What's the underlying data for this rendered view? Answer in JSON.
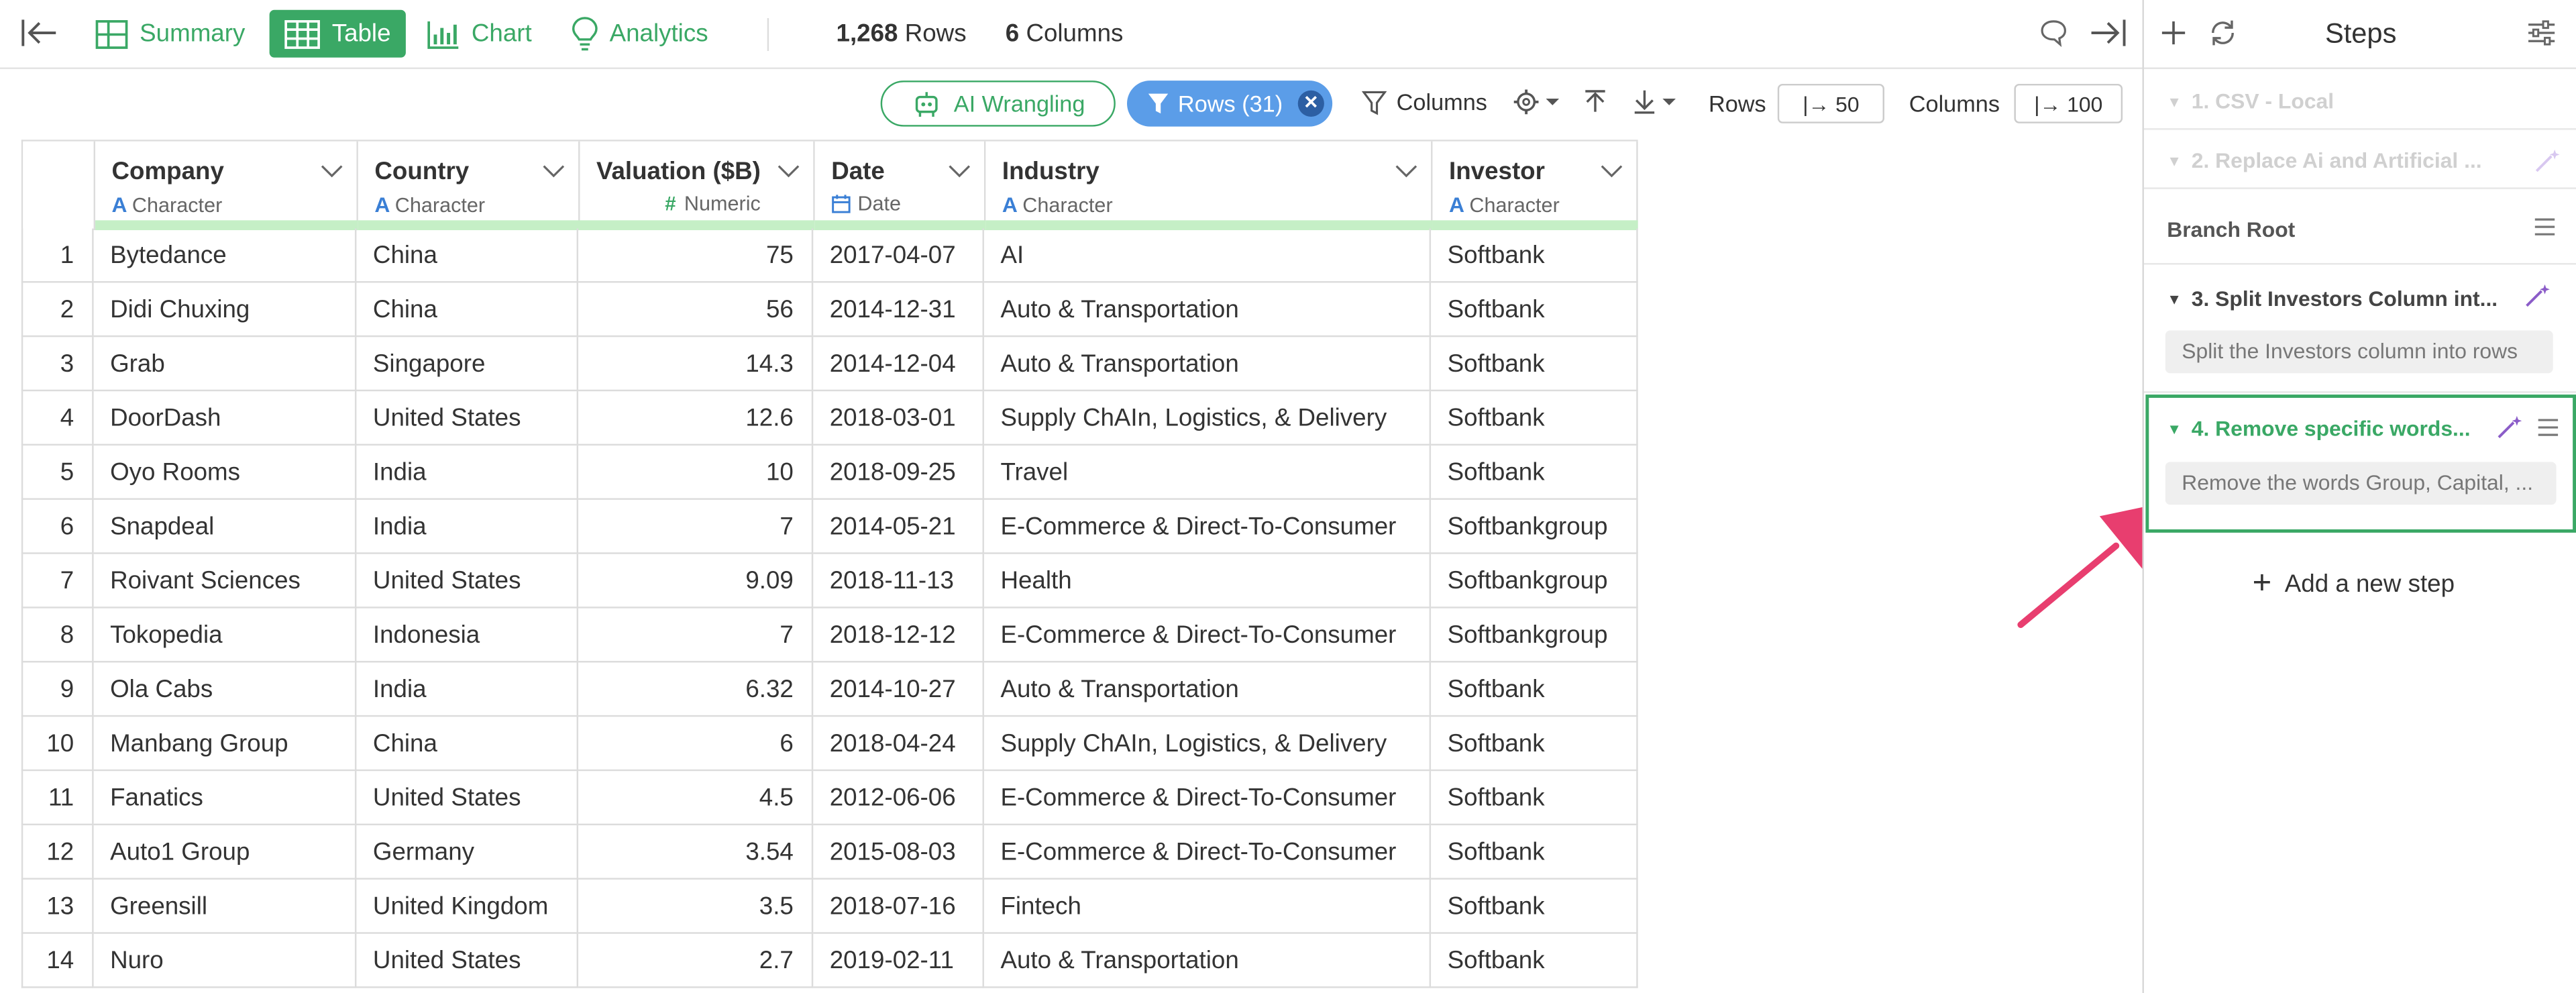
{
  "toolbar": {
    "tabs": [
      {
        "label": "Summary"
      },
      {
        "label": "Table"
      },
      {
        "label": "Chart"
      },
      {
        "label": "Analytics"
      }
    ],
    "rows_count": "1,268",
    "rows_label": "Rows",
    "cols_count": "6",
    "cols_label": "Columns",
    "ai_label": "AI Wrangling",
    "rows_filter_label": "Rows (31)",
    "columns_filter_label": "Columns",
    "rows_label2": "Rows",
    "rows_value": "|→ 50",
    "columns_label2": "Columns",
    "columns_value": "|→ 100"
  },
  "table": {
    "columns": [
      {
        "name": "Company",
        "type": "Character",
        "kind": "A"
      },
      {
        "name": "Country",
        "type": "Character",
        "kind": "A"
      },
      {
        "name": "Valuation ($B)",
        "type": "Numeric",
        "kind": "#"
      },
      {
        "name": "Date",
        "type": "Date",
        "kind": "date"
      },
      {
        "name": "Industry",
        "type": "Character",
        "kind": "A"
      },
      {
        "name": "Investor",
        "type": "Character",
        "kind": "A"
      }
    ],
    "rows": [
      [
        "1",
        "Bytedance",
        "China",
        "75",
        "2017-04-07",
        "AI",
        "Softbank"
      ],
      [
        "2",
        "Didi Chuxing",
        "China",
        "56",
        "2014-12-31",
        "Auto & Transportation",
        "Softbank"
      ],
      [
        "3",
        "Grab",
        "Singapore",
        "14.3",
        "2014-12-04",
        "Auto & Transportation",
        "Softbank"
      ],
      [
        "4",
        "DoorDash",
        "United States",
        "12.6",
        "2018-03-01",
        "Supply ChAIn, Logistics, & Delivery",
        "Softbank"
      ],
      [
        "5",
        "Oyo Rooms",
        "India",
        "10",
        "2018-09-25",
        "Travel",
        "Softbank"
      ],
      [
        "6",
        "Snapdeal",
        "India",
        "7",
        "2014-05-21",
        "E-Commerce & Direct-To-Consumer",
        "Softbankgroup"
      ],
      [
        "7",
        "Roivant Sciences",
        "United States",
        "9.09",
        "2018-11-13",
        "Health",
        "Softbankgroup"
      ],
      [
        "8",
        "Tokopedia",
        "Indonesia",
        "7",
        "2018-12-12",
        "E-Commerce & Direct-To-Consumer",
        "Softbankgroup"
      ],
      [
        "9",
        "Ola Cabs",
        "India",
        "6.32",
        "2014-10-27",
        "Auto & Transportation",
        "Softbank"
      ],
      [
        "10",
        "Manbang Group",
        "China",
        "6",
        "2018-04-24",
        "Supply ChAIn, Logistics, & Delivery",
        "Softbank"
      ],
      [
        "11",
        "Fanatics",
        "United States",
        "4.5",
        "2012-06-06",
        "E-Commerce & Direct-To-Consumer",
        "Softbank"
      ],
      [
        "12",
        "Auto1 Group",
        "Germany",
        "3.54",
        "2015-08-03",
        "E-Commerce & Direct-To-Consumer",
        "Softbank"
      ],
      [
        "13",
        "Greensill",
        "United Kingdom",
        "3.5",
        "2018-07-16",
        "Fintech",
        "Softbank"
      ],
      [
        "14",
        "Nuro",
        "United States",
        "2.7",
        "2019-02-11",
        "Auto & Transportation",
        "Softbank"
      ]
    ]
  },
  "steps_panel": {
    "title": "Steps",
    "steps": [
      {
        "title": "1. CSV - Local",
        "state": "disabled"
      },
      {
        "title": "2. Replace Ai and Artificial ...",
        "state": "disabled"
      },
      {
        "title": "Branch Root",
        "state": "branch"
      },
      {
        "title": "3. Split Investors Column int...",
        "description": "Split the Investors column into rows",
        "state": "normal"
      },
      {
        "title": "4. Remove specific words...",
        "description": "Remove the words Group, Capital, ...",
        "state": "selected"
      }
    ],
    "add_step_label": "Add a new step"
  },
  "colors": {
    "accent_green": "#3aa865",
    "filter_blue": "#5b9de8",
    "type_blue": "#3a7fd5",
    "quality_bar": "#c5efc6",
    "arrow_pink": "#e83e6f"
  }
}
